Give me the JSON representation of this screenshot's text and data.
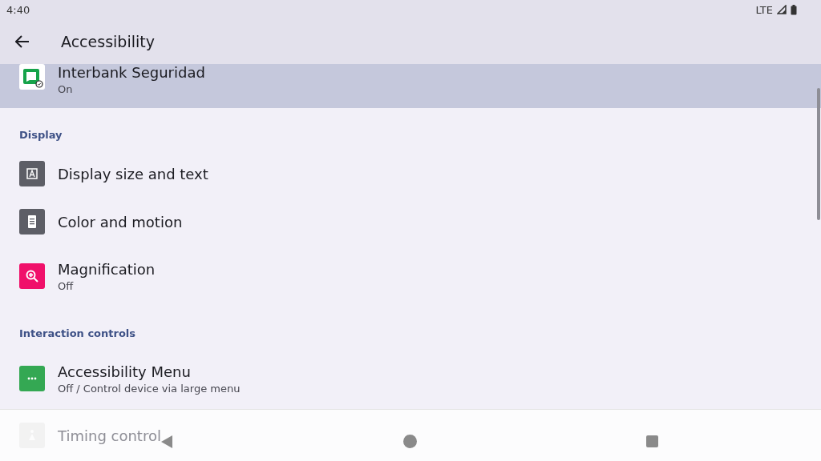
{
  "status_bar": {
    "time": "4:40",
    "network": "LTE"
  },
  "app_bar": {
    "title": "Accessibility"
  },
  "sections": [
    {
      "items": [
        {
          "kind": "app",
          "title": "Interbank Seguridad",
          "summary": "On",
          "selected": true
        }
      ]
    },
    {
      "header": "Display",
      "items": [
        {
          "kind": "text-size",
          "title": "Display size and text",
          "selected": false
        },
        {
          "kind": "color-motion",
          "title": "Color and motion",
          "selected": false
        },
        {
          "kind": "magnify",
          "title": "Magnification",
          "summary": "Off",
          "selected": false
        }
      ]
    },
    {
      "header": "Interaction controls",
      "items": [
        {
          "kind": "menu",
          "title": "Accessibility Menu",
          "summary": "Off / Control device via large menu",
          "selected": false
        },
        {
          "kind": "timer",
          "title": "Timing control",
          "selected": false
        }
      ]
    }
  ]
}
